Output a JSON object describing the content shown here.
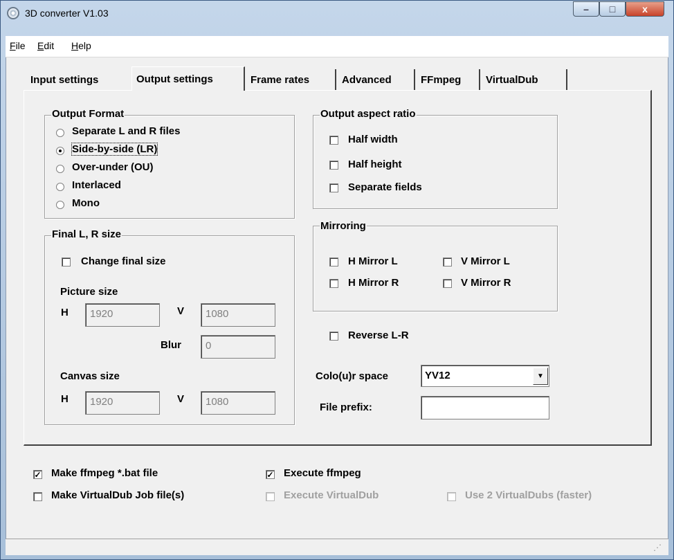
{
  "window": {
    "title": "3D converter V1.03"
  },
  "caption_buttons": {
    "minimize": "–",
    "maximize": "□",
    "close": "x"
  },
  "menu": [
    {
      "key": "F",
      "rest": "ile"
    },
    {
      "key": "E",
      "rest": "dit"
    },
    {
      "key": "H",
      "rest": "elp"
    }
  ],
  "tabs": [
    {
      "label": "Input settings",
      "active": false
    },
    {
      "label": "Output settings",
      "active": true
    },
    {
      "label": "Frame rates",
      "active": false
    },
    {
      "label": "Advanced",
      "active": false
    },
    {
      "label": "FFmpeg",
      "active": false
    },
    {
      "label": "VirtualDub",
      "active": false
    }
  ],
  "output_format": {
    "title": "Output Format",
    "options": [
      {
        "label": "Separate L and R files",
        "selected": false
      },
      {
        "label": "Side-by-side (LR)",
        "selected": true
      },
      {
        "label": "Over-under (OU)",
        "selected": false
      },
      {
        "label": "Interlaced",
        "selected": false
      },
      {
        "label": "Mono",
        "selected": false
      }
    ]
  },
  "final_size": {
    "title": "Final L, R size",
    "change_final_size": {
      "label": "Change final size",
      "checked": false
    },
    "picture_size_label": "Picture size",
    "picture_h_label": "H",
    "picture_h": "1920",
    "picture_v_label": "V",
    "picture_v": "1080",
    "blur_label": "Blur",
    "blur": "0",
    "canvas_size_label": "Canvas size",
    "canvas_h_label": "H",
    "canvas_h": "1920",
    "canvas_v_label": "V",
    "canvas_v": "1080"
  },
  "aspect_ratio": {
    "title": "Output aspect ratio",
    "half_width": {
      "label": "Half width",
      "checked": false
    },
    "half_height": {
      "label": "Half height",
      "checked": false
    },
    "separate_fields": {
      "label": "Separate fields",
      "checked": false
    }
  },
  "mirroring": {
    "title": "Mirroring",
    "h_mirror_l": {
      "label": "H Mirror L",
      "checked": false
    },
    "v_mirror_l": {
      "label": "V Mirror L",
      "checked": false
    },
    "h_mirror_r": {
      "label": "H Mirror R",
      "checked": false
    },
    "v_mirror_r": {
      "label": "V Mirror R",
      "checked": false
    }
  },
  "reverse_lr": {
    "label": "Reverse L-R",
    "checked": false
  },
  "colour_space": {
    "label": "Colo(u)r space",
    "value": "YV12"
  },
  "file_prefix": {
    "label": "File prefix:",
    "value": ""
  },
  "bottom": {
    "make_ffmpeg_bat": {
      "label": "Make ffmpeg *.bat file",
      "checked": true
    },
    "execute_ffmpeg": {
      "label": "Execute ffmpeg",
      "checked": true
    },
    "make_virtualdub_job": {
      "label": "Make VirtualDub Job file(s)",
      "checked": false
    },
    "execute_virtualdub": {
      "label": "Execute VirtualDub",
      "checked": false,
      "disabled": true
    },
    "use_2_virtualdubs": {
      "label": "Use 2 VirtualDubs (faster)",
      "checked": false,
      "disabled": true
    }
  },
  "colors": {
    "titlebar": "#b9cde3",
    "close_button": "#c8432a",
    "panel": "#f0f0f0"
  }
}
